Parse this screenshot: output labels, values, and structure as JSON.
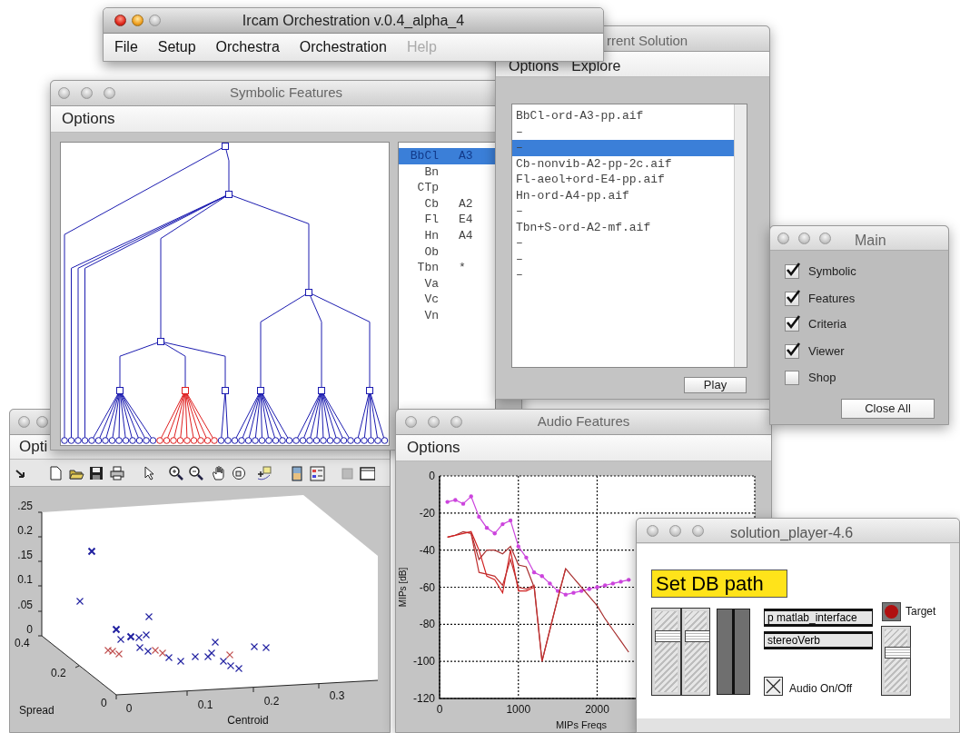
{
  "app_window": {
    "title": "Ircam Orchestration v.0.4_alpha_4",
    "menu": [
      {
        "label": "File",
        "disabled": false
      },
      {
        "label": "Setup",
        "disabled": false
      },
      {
        "label": "Orchestra",
        "disabled": false
      },
      {
        "label": "Orchestration",
        "disabled": false
      },
      {
        "label": "Help",
        "disabled": true
      }
    ]
  },
  "solution_window": {
    "title": "rrent Solution",
    "menu": [
      "Options",
      "Explore"
    ],
    "files": [
      {
        "label": "BbCl-ord-A3-pp.aif",
        "selected": false
      },
      {
        "label": "–",
        "selected": false
      },
      {
        "label": "–",
        "selected": true
      },
      {
        "label": "Cb-nonvib-A2-pp-2c.aif",
        "selected": false
      },
      {
        "label": "Fl-aeol+ord-E4-pp.aif",
        "selected": false
      },
      {
        "label": "Hn-ord-A4-pp.aif",
        "selected": false
      },
      {
        "label": "–",
        "selected": false
      },
      {
        "label": "Tbn+S-ord-A2-mf.aif",
        "selected": false
      },
      {
        "label": "–",
        "selected": false
      },
      {
        "label": "–",
        "selected": false
      },
      {
        "label": "–",
        "selected": false
      }
    ],
    "play_button": "Play"
  },
  "symbolic_window": {
    "title": "Symbolic Features",
    "menu": [
      "Options"
    ],
    "instruments": [
      {
        "name": "BbCl",
        "note": "A3",
        "selected": true
      },
      {
        "name": "Bn",
        "selected": false
      },
      {
        "name": "CTp",
        "selected": false
      },
      {
        "name": "Cb",
        "note": "A2",
        "selected": false
      },
      {
        "name": "Fl",
        "note": "E4",
        "selected": false
      },
      {
        "name": "Hn",
        "note": "A4",
        "selected": false
      },
      {
        "name": "Ob",
        "selected": false
      },
      {
        "name": "Tbn",
        "note": "*",
        "selected": false
      },
      {
        "name": "Va",
        "selected": false
      },
      {
        "name": "Vc",
        "selected": false
      },
      {
        "name": "Vn",
        "selected": false
      }
    ]
  },
  "main_window": {
    "title": "Main",
    "options": [
      {
        "label": "Symbolic",
        "checked": true
      },
      {
        "label": "Features",
        "checked": true
      },
      {
        "label": "Criteria",
        "checked": true
      },
      {
        "label": "Viewer",
        "checked": true
      },
      {
        "label": "Shop",
        "checked": false
      }
    ],
    "close_button": "Close All"
  },
  "plot3d_window": {
    "menu": [
      "Opti"
    ],
    "z_ticks": [
      ".25",
      "0.2",
      ".15",
      "0.1",
      ".05",
      "0"
    ],
    "y_ticks": [
      "0.4",
      "0.2",
      "0"
    ],
    "y_label": "Spread",
    "x_ticks": [
      "0",
      "0.1",
      "0.2",
      "0.3"
    ],
    "x_label": "Centroid"
  },
  "audio_window": {
    "title": "Audio Features",
    "menu": [
      "Options"
    ],
    "chart_data": {
      "type": "line",
      "xlabel": "MIPs Freqs",
      "ylabel": "MIPs [dB]",
      "x": [
        100,
        200,
        300,
        400,
        500,
        600,
        700,
        800,
        900,
        1000,
        1100,
        1200,
        1300,
        1400,
        1500,
        1600,
        1700,
        1800,
        1900,
        2000,
        2100,
        2200,
        2300,
        2400
      ],
      "series": [
        {
          "color": "#cc44dd",
          "values": [
            -14,
            -13,
            -15,
            -11,
            -22,
            -28,
            -31,
            -26,
            -24,
            -38,
            -44,
            -52,
            -54,
            -58,
            -62,
            -64,
            -63,
            -62,
            -61,
            -60,
            -59,
            -58,
            -57,
            -56
          ]
        },
        {
          "color": "#a83030",
          "values": [
            -33,
            -32,
            -30,
            -31,
            -45,
            -40,
            -40,
            -42,
            -38,
            -48,
            -49,
            -60,
            -100,
            -83,
            -66,
            -50,
            -55,
            -60,
            -65,
            -70,
            -77,
            -83,
            -89,
            -95
          ]
        },
        {
          "color": "#d02020",
          "values": [
            -33,
            -32,
            -31,
            -30,
            -40,
            -54,
            -56,
            -63,
            -40,
            -62,
            -62,
            -60,
            null,
            null,
            null,
            null,
            null,
            null,
            null,
            null,
            null,
            null,
            null,
            null
          ]
        },
        {
          "color": "#c03030",
          "values": [
            null,
            null,
            null,
            -31,
            -52,
            -53,
            -54,
            -59,
            -45,
            -60,
            -61,
            -59,
            -100,
            -83,
            -66,
            -50,
            null,
            null,
            null,
            null,
            null,
            null,
            null,
            null
          ]
        }
      ],
      "grid": true,
      "xlim": [
        0,
        4000
      ],
      "ylim": [
        -120,
        0
      ],
      "xticks": [
        0,
        1000,
        2000
      ],
      "yticks": [
        0,
        -20,
        -40,
        -60,
        -80,
        -100,
        -120
      ]
    }
  },
  "player_window": {
    "title": "solution_player-4.6",
    "db_button": "Set DB path",
    "sliders": [
      {
        "level": 0.72
      },
      {
        "level": 0.72
      }
    ],
    "patches": [
      "p matlab_interface",
      "stereoVerb"
    ],
    "audio_toggle": {
      "label": "Audio On/Off",
      "checked": true
    },
    "target_label": "Target",
    "target_slider": {
      "level": 0.66
    }
  }
}
